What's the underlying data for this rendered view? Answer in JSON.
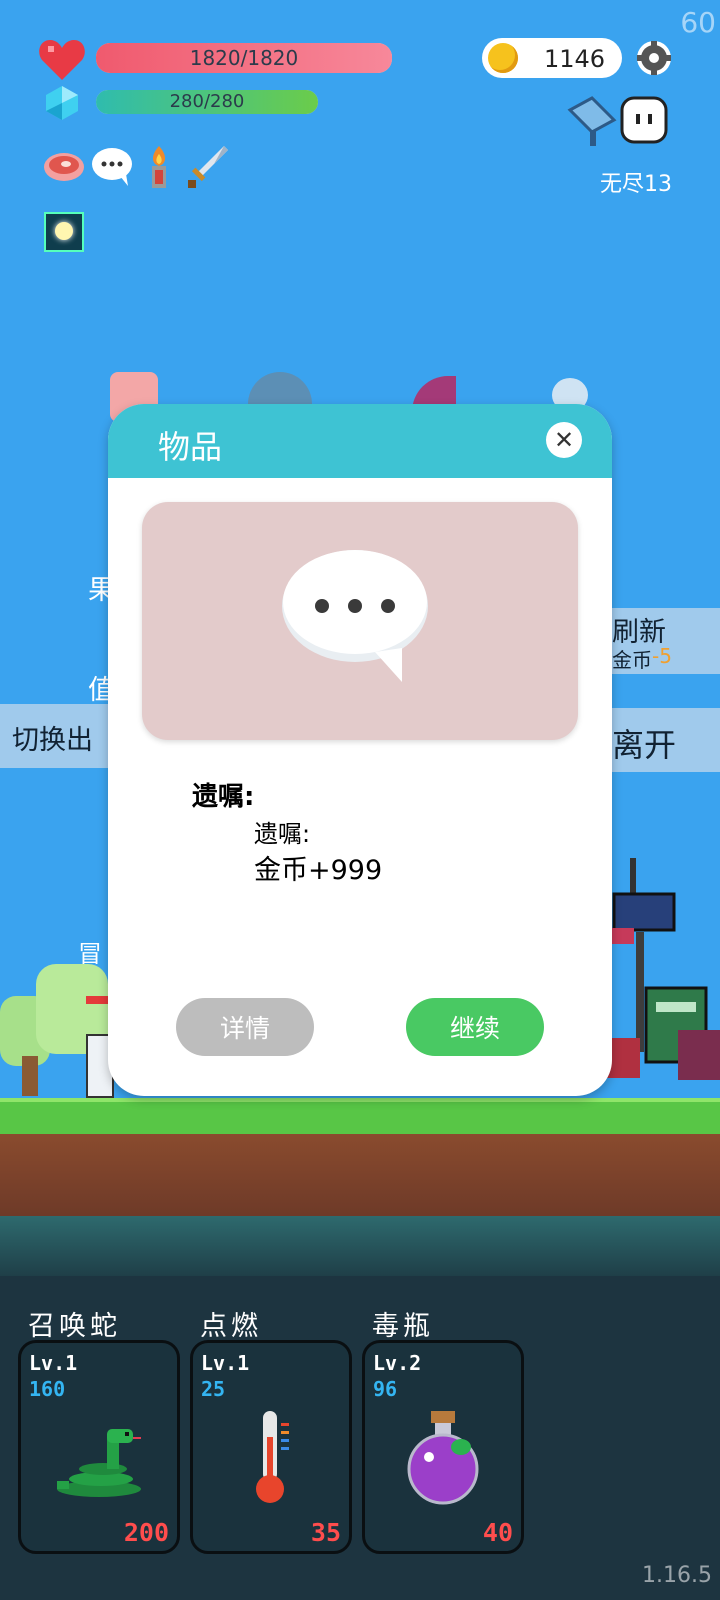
{
  "fps": "60",
  "version": "1.16.5",
  "status": {
    "hp_text": "1820/1820",
    "hp_fraction": 1.0,
    "mp_text": "280/280",
    "mp_fraction": 1.0
  },
  "coins": "1146",
  "mode_label": "无尽13",
  "backdrop": {
    "switch_label": "切换出",
    "refresh_label": "刷新",
    "refresh_cost_label": "金币",
    "refresh_cost_value": "-5",
    "leave_label": "离开",
    "frag_1": "果",
    "frag_2": "值",
    "frag_3": "冒"
  },
  "dialog": {
    "title": "物品",
    "item_name": "遗嘱:",
    "desc_line1": "遗嘱:",
    "desc_line2": "金币+999",
    "detail_button": "详情",
    "continue_button": "继续"
  },
  "skills": [
    {
      "name": "召唤蛇",
      "level": "Lv.1",
      "value": "160",
      "cost": "200",
      "icon": "snake-icon"
    },
    {
      "name": "点燃",
      "level": "Lv.1",
      "value": "25",
      "cost": "35",
      "icon": "thermometer-icon"
    },
    {
      "name": "毒瓶",
      "level": "Lv.2",
      "value": "96",
      "cost": "40",
      "icon": "poison-bottle-icon"
    }
  ],
  "colors": {
    "sky": "#3aa3ef",
    "hp": "#f36b7e",
    "mp": "#62c75a",
    "dialog_header": "#3ec3d3",
    "continue": "#49c963",
    "cost": "#ff4d4d",
    "skill_value": "#34b5f2"
  }
}
